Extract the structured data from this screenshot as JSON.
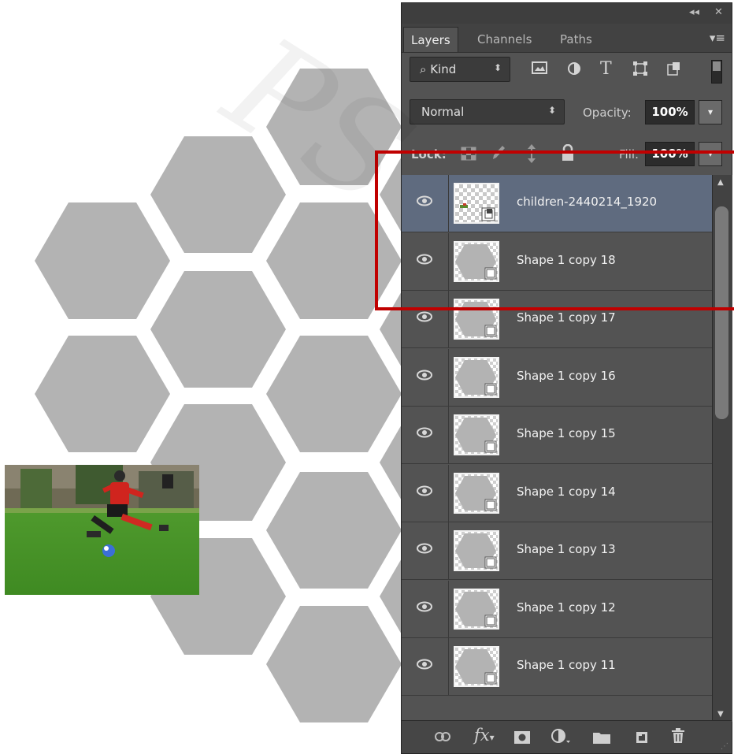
{
  "panel": {
    "collapse_icon": "◂◂",
    "close_icon": "✕",
    "tabs": [
      {
        "label": "Layers",
        "active": true
      },
      {
        "label": "Channels",
        "active": false
      },
      {
        "label": "Paths",
        "active": false
      }
    ],
    "filter": {
      "kind_label": "Kind",
      "search_icon": "⌕",
      "arrows": "⬍"
    },
    "blend_mode": "Normal",
    "opacity_label": "Opacity:",
    "opacity_value": "100%",
    "lock_label": "Lock:",
    "fill_label": "Fill:",
    "fill_value": "100%",
    "layers": [
      {
        "name": "children-2440214_1920",
        "selected": true,
        "kind": "smart-object"
      },
      {
        "name": "Shape 1 copy 18",
        "selected": false,
        "kind": "shape"
      },
      {
        "name": "Shape 1 copy 17",
        "selected": false,
        "kind": "shape"
      },
      {
        "name": "Shape 1 copy 16",
        "selected": false,
        "kind": "shape"
      },
      {
        "name": "Shape 1 copy 15",
        "selected": false,
        "kind": "shape"
      },
      {
        "name": "Shape 1 copy 14",
        "selected": false,
        "kind": "shape"
      },
      {
        "name": "Shape 1 copy 13",
        "selected": false,
        "kind": "shape"
      },
      {
        "name": "Shape 1 copy 12",
        "selected": false,
        "kind": "shape"
      },
      {
        "name": "Shape 1 copy 11",
        "selected": false,
        "kind": "shape"
      }
    ],
    "bottom_icons": [
      "link-icon",
      "fx-icon",
      "mask-icon",
      "adjustment-icon",
      "folder-icon",
      "new-layer-icon",
      "trash-icon"
    ],
    "fx_label": "fx"
  },
  "colors": {
    "panel_bg": "#535353",
    "selected_row": "#5f6b7f",
    "hexagon": "#b3b3b3",
    "highlight": "#c00000"
  },
  "watermark": "PS"
}
